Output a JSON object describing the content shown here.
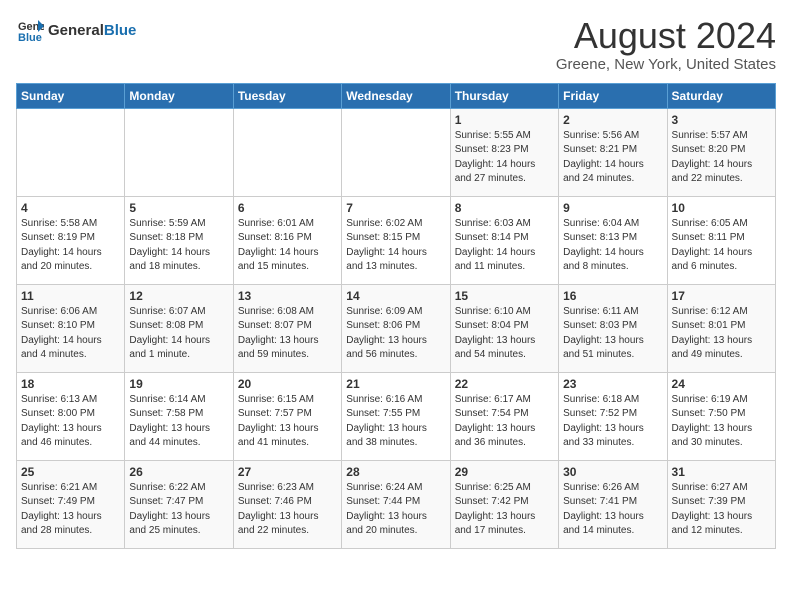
{
  "header": {
    "logo_general": "General",
    "logo_blue": "Blue",
    "title": "August 2024",
    "subtitle": "Greene, New York, United States"
  },
  "columns": [
    "Sunday",
    "Monday",
    "Tuesday",
    "Wednesday",
    "Thursday",
    "Friday",
    "Saturday"
  ],
  "weeks": [
    [
      {
        "day": "",
        "info": ""
      },
      {
        "day": "",
        "info": ""
      },
      {
        "day": "",
        "info": ""
      },
      {
        "day": "",
        "info": ""
      },
      {
        "day": "1",
        "info": "Sunrise: 5:55 AM\nSunset: 8:23 PM\nDaylight: 14 hours\nand 27 minutes."
      },
      {
        "day": "2",
        "info": "Sunrise: 5:56 AM\nSunset: 8:21 PM\nDaylight: 14 hours\nand 24 minutes."
      },
      {
        "day": "3",
        "info": "Sunrise: 5:57 AM\nSunset: 8:20 PM\nDaylight: 14 hours\nand 22 minutes."
      }
    ],
    [
      {
        "day": "4",
        "info": "Sunrise: 5:58 AM\nSunset: 8:19 PM\nDaylight: 14 hours\nand 20 minutes."
      },
      {
        "day": "5",
        "info": "Sunrise: 5:59 AM\nSunset: 8:18 PM\nDaylight: 14 hours\nand 18 minutes."
      },
      {
        "day": "6",
        "info": "Sunrise: 6:01 AM\nSunset: 8:16 PM\nDaylight: 14 hours\nand 15 minutes."
      },
      {
        "day": "7",
        "info": "Sunrise: 6:02 AM\nSunset: 8:15 PM\nDaylight: 14 hours\nand 13 minutes."
      },
      {
        "day": "8",
        "info": "Sunrise: 6:03 AM\nSunset: 8:14 PM\nDaylight: 14 hours\nand 11 minutes."
      },
      {
        "day": "9",
        "info": "Sunrise: 6:04 AM\nSunset: 8:13 PM\nDaylight: 14 hours\nand 8 minutes."
      },
      {
        "day": "10",
        "info": "Sunrise: 6:05 AM\nSunset: 8:11 PM\nDaylight: 14 hours\nand 6 minutes."
      }
    ],
    [
      {
        "day": "11",
        "info": "Sunrise: 6:06 AM\nSunset: 8:10 PM\nDaylight: 14 hours\nand 4 minutes."
      },
      {
        "day": "12",
        "info": "Sunrise: 6:07 AM\nSunset: 8:08 PM\nDaylight: 14 hours\nand 1 minute."
      },
      {
        "day": "13",
        "info": "Sunrise: 6:08 AM\nSunset: 8:07 PM\nDaylight: 13 hours\nand 59 minutes."
      },
      {
        "day": "14",
        "info": "Sunrise: 6:09 AM\nSunset: 8:06 PM\nDaylight: 13 hours\nand 56 minutes."
      },
      {
        "day": "15",
        "info": "Sunrise: 6:10 AM\nSunset: 8:04 PM\nDaylight: 13 hours\nand 54 minutes."
      },
      {
        "day": "16",
        "info": "Sunrise: 6:11 AM\nSunset: 8:03 PM\nDaylight: 13 hours\nand 51 minutes."
      },
      {
        "day": "17",
        "info": "Sunrise: 6:12 AM\nSunset: 8:01 PM\nDaylight: 13 hours\nand 49 minutes."
      }
    ],
    [
      {
        "day": "18",
        "info": "Sunrise: 6:13 AM\nSunset: 8:00 PM\nDaylight: 13 hours\nand 46 minutes."
      },
      {
        "day": "19",
        "info": "Sunrise: 6:14 AM\nSunset: 7:58 PM\nDaylight: 13 hours\nand 44 minutes."
      },
      {
        "day": "20",
        "info": "Sunrise: 6:15 AM\nSunset: 7:57 PM\nDaylight: 13 hours\nand 41 minutes."
      },
      {
        "day": "21",
        "info": "Sunrise: 6:16 AM\nSunset: 7:55 PM\nDaylight: 13 hours\nand 38 minutes."
      },
      {
        "day": "22",
        "info": "Sunrise: 6:17 AM\nSunset: 7:54 PM\nDaylight: 13 hours\nand 36 minutes."
      },
      {
        "day": "23",
        "info": "Sunrise: 6:18 AM\nSunset: 7:52 PM\nDaylight: 13 hours\nand 33 minutes."
      },
      {
        "day": "24",
        "info": "Sunrise: 6:19 AM\nSunset: 7:50 PM\nDaylight: 13 hours\nand 30 minutes."
      }
    ],
    [
      {
        "day": "25",
        "info": "Sunrise: 6:21 AM\nSunset: 7:49 PM\nDaylight: 13 hours\nand 28 minutes."
      },
      {
        "day": "26",
        "info": "Sunrise: 6:22 AM\nSunset: 7:47 PM\nDaylight: 13 hours\nand 25 minutes."
      },
      {
        "day": "27",
        "info": "Sunrise: 6:23 AM\nSunset: 7:46 PM\nDaylight: 13 hours\nand 22 minutes."
      },
      {
        "day": "28",
        "info": "Sunrise: 6:24 AM\nSunset: 7:44 PM\nDaylight: 13 hours\nand 20 minutes."
      },
      {
        "day": "29",
        "info": "Sunrise: 6:25 AM\nSunset: 7:42 PM\nDaylight: 13 hours\nand 17 minutes."
      },
      {
        "day": "30",
        "info": "Sunrise: 6:26 AM\nSunset: 7:41 PM\nDaylight: 13 hours\nand 14 minutes."
      },
      {
        "day": "31",
        "info": "Sunrise: 6:27 AM\nSunset: 7:39 PM\nDaylight: 13 hours\nand 12 minutes."
      }
    ]
  ]
}
